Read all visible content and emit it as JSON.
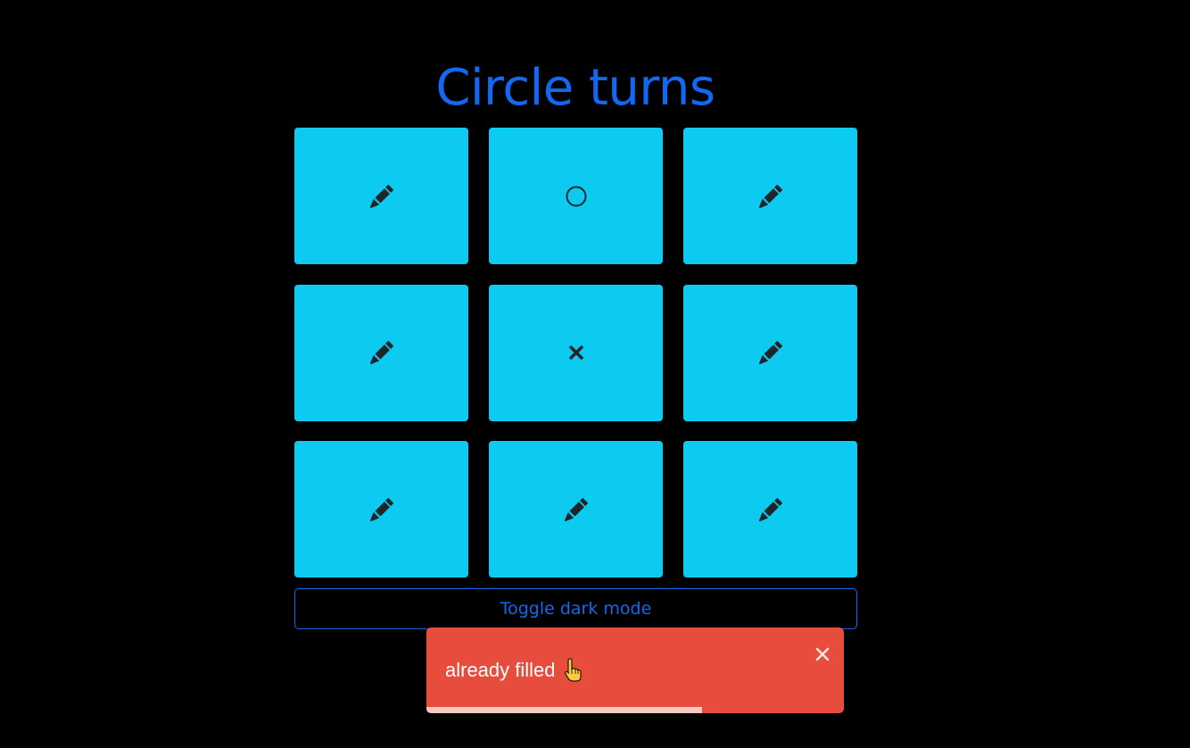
{
  "title": "Circle turns",
  "board": {
    "cells": [
      {
        "state": "empty",
        "icon": "pencil-icon"
      },
      {
        "state": "O",
        "icon": "circle-icon"
      },
      {
        "state": "empty",
        "icon": "pencil-icon"
      },
      {
        "state": "empty",
        "icon": "pencil-icon"
      },
      {
        "state": "X",
        "icon": "x-mark-icon"
      },
      {
        "state": "empty",
        "icon": "pencil-icon"
      },
      {
        "state": "empty",
        "icon": "pencil-icon"
      },
      {
        "state": "empty",
        "icon": "pencil-icon"
      },
      {
        "state": "empty",
        "icon": "pencil-icon"
      }
    ],
    "cell_color": "#0dcaf0",
    "icon_color": "#212529"
  },
  "toggle_button": {
    "label": "Toggle dark mode"
  },
  "toast": {
    "message": "already filled",
    "emoji_icon": "pointing-hand-icon",
    "close_icon": "close-icon",
    "progress": 0.66,
    "color": "#e74c3c"
  },
  "colors": {
    "background": "#000000",
    "accent": "#1168f3"
  }
}
